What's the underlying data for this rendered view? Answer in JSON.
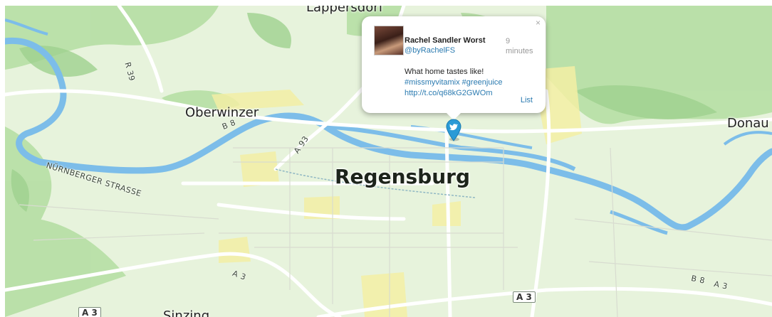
{
  "map": {
    "labels": {
      "regensburg": "Regensburg",
      "lappersdorf": "Lappersdorf",
      "oberwinzer": "Oberwinzer",
      "donau": "Donau",
      "sinzing": "Sinzing",
      "nuernberger_strasse": "NÜRNBERGER STRASSE",
      "r39": "R 39",
      "b8_left": "B 8",
      "a93": "A 93",
      "a3_left": "A 3",
      "b8_right": "B 8",
      "a3_right": "A 3"
    },
    "shields": {
      "a3_center": "A 3",
      "a3_bottom_left": "A 3"
    },
    "colors": {
      "land": "#e7f3dc",
      "water": "#7cbde9",
      "forest": "#a9d89a",
      "urban": "#f4f0a8"
    },
    "marker_icon": "twitter-bird-icon"
  },
  "popup": {
    "close_label": "×",
    "name": "Rachel Sandler Worst",
    "handle": "@byRachelFS",
    "time": "9 minutes",
    "text": "What home tastes like!",
    "hashtags": "#missmyvitamix #greenjuice",
    "link": "http://t.co/q68kG2GWOm",
    "list_link": "List"
  }
}
